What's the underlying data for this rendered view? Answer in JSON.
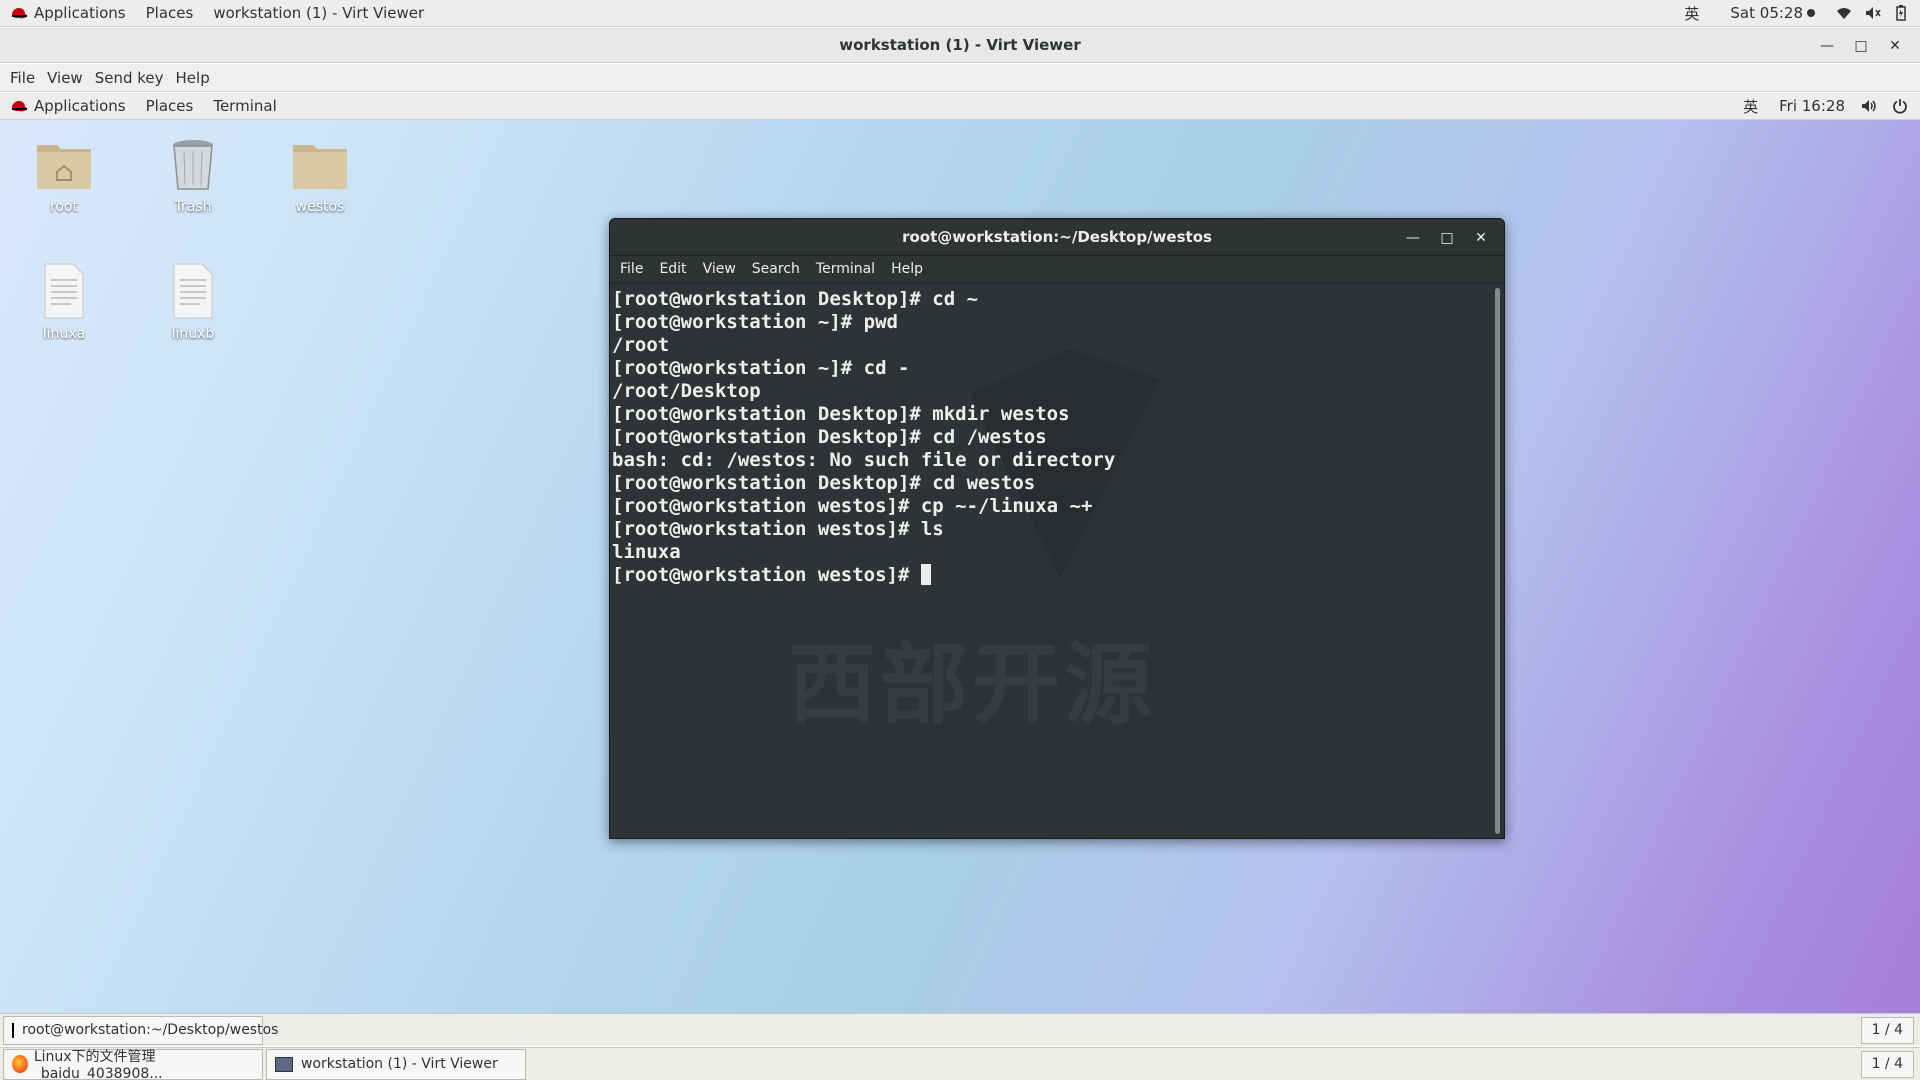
{
  "host_topbar": {
    "applications": "Applications",
    "places": "Places",
    "window_label": "workstation (1) - Virt Viewer",
    "input_method": "英",
    "clock": "Sat 05:28"
  },
  "virt_viewer": {
    "title": "workstation (1) - Virt Viewer",
    "menu": [
      "File",
      "View",
      "Send key",
      "Help"
    ]
  },
  "guest_topbar": {
    "applications": "Applications",
    "places": "Places",
    "terminal": "Terminal",
    "input_method": "英",
    "clock": "Fri 16:28"
  },
  "desktop_icons": [
    {
      "label": "root"
    },
    {
      "label": "Trash"
    },
    {
      "label": "westos"
    },
    {
      "label": "linuxa"
    },
    {
      "label": "linuxb"
    }
  ],
  "terminal": {
    "title": "root@workstation:~/Desktop/westos",
    "menu": [
      "File",
      "Edit",
      "View",
      "Search",
      "Terminal",
      "Help"
    ],
    "lines": [
      "[root@workstation Desktop]# cd ~",
      "[root@workstation ~]# pwd",
      "/root",
      "[root@workstation ~]# cd -",
      "/root/Desktop",
      "[root@workstation Desktop]# mkdir westos",
      "[root@workstation Desktop]# cd /westos",
      "bash: cd: /westos: No such file or directory",
      "[root@workstation Desktop]# cd westos",
      "[root@workstation westos]# cp ~-/linuxa ~+",
      "[root@workstation westos]# ls",
      "linuxa"
    ],
    "prompt": "[root@workstation westos]# ",
    "watermark": "西部开源"
  },
  "guest_taskbar": {
    "task": "root@workstation:~/Desktop/westos",
    "pager": "1 / 4"
  },
  "host_taskbar": {
    "task1": "Linux下的文件管理_baidu_4038908...",
    "task2": "workstation (1) - Virt Viewer",
    "pager": "1 / 4"
  }
}
